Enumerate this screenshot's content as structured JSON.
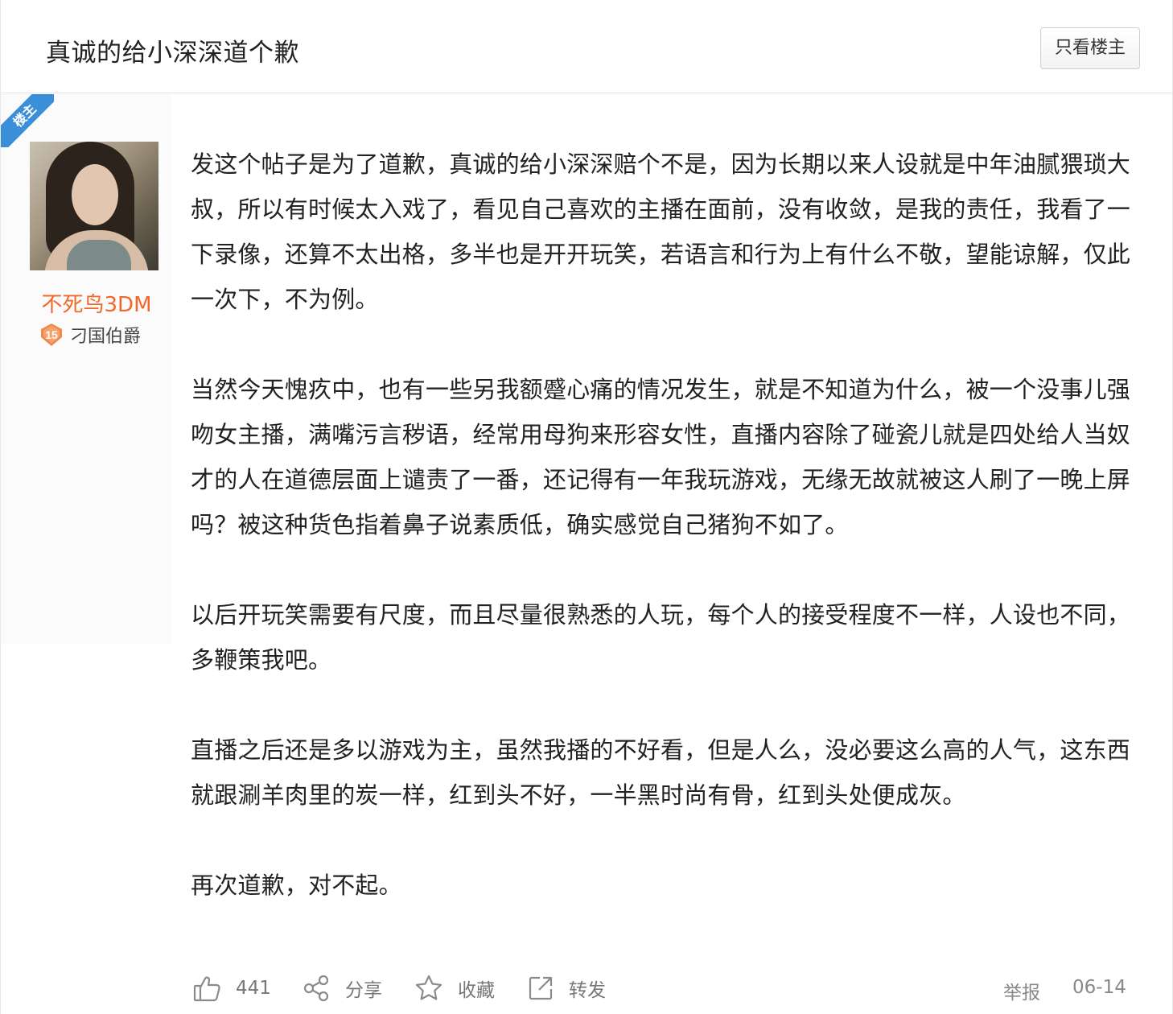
{
  "header": {
    "title": "真诚的给小深深道个歉",
    "only_op_label": "只看楼主"
  },
  "author": {
    "op_tag": "楼主",
    "name": "不死鸟3DM",
    "level": "15",
    "title": "刁国伯爵",
    "name_color": "#f2672a"
  },
  "post": {
    "paragraphs": [
      "发这个帖子是为了道歉，真诚的给小深深赔个不是，因为长期以来人设就是中年油腻猥琐大叔，所以有时候太入戏了，看见自己喜欢的主播在面前，没有收敛，是我的责任，我看了一下录像，还算不太出格，多半也是开开玩笑，若语言和行为上有什么不敬，望能谅解，仅此一次下，不为例。",
      "当然今天愧疚中，也有一些另我额蹙心痛的情况发生，就是不知道为什么，被一个没事儿强吻女主播，满嘴污言秽语，经常用母狗来形容女性，直播内容除了碰瓷儿就是四处给人当奴才的人在道德层面上谴责了一番，还记得有一年我玩游戏，无缘无故就被这人刷了一晚上屏吗？被这种货色指着鼻子说素质低，确实感觉自己猪狗不如了。",
      "以后开玩笑需要有尺度，而且尽量很熟悉的人玩，每个人的接受程度不一样，人设也不同，多鞭策我吧。",
      "直播之后还是多以游戏为主，虽然我播的不好看，但是人么，没必要这么高的人气，这东西就跟涮羊肉里的炭一样，红到头不好，一半黑时尚有骨，红到头处便成灰。",
      "再次道歉，对不起。"
    ]
  },
  "actions": {
    "like_count": "441",
    "share_label": "分享",
    "favorite_label": "收藏",
    "forward_label": "转发",
    "report_label": "举报",
    "date": "06-14"
  },
  "icons": {
    "like": "thumbs-up-icon",
    "share": "share-icon",
    "favorite": "star-icon",
    "forward": "forward-icon",
    "level": "level-badge-icon"
  },
  "colors": {
    "accent_blue": "#3a8fd8",
    "username": "#f2672a",
    "level_badge": "#f08a4b"
  }
}
